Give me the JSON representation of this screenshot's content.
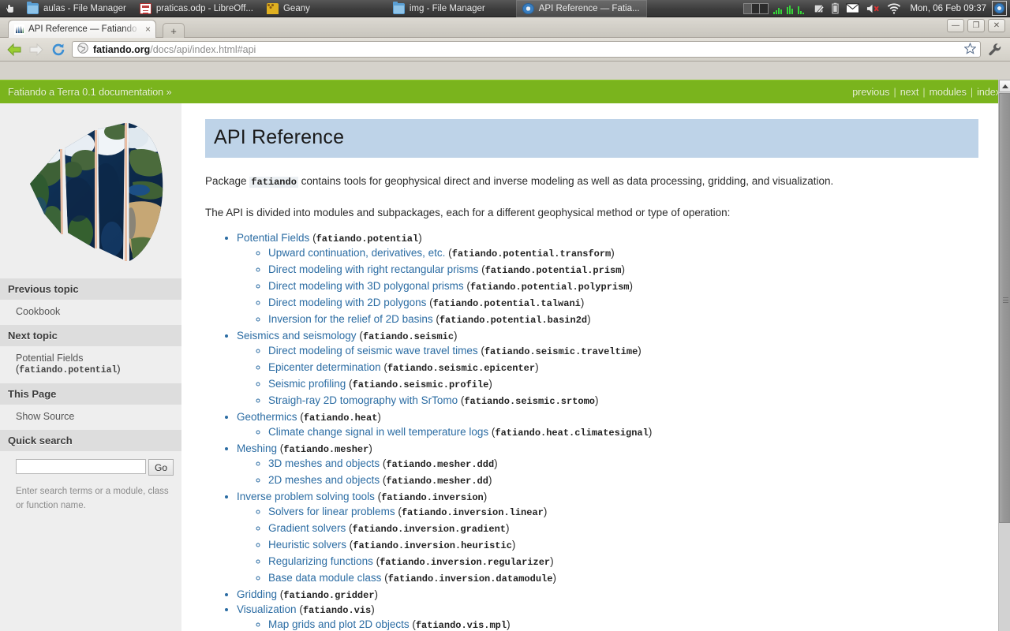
{
  "taskbar": {
    "tasks": [
      {
        "label": "aulas - File Manager",
        "icon": "folder-icon",
        "active": false
      },
      {
        "label": "praticas.odp - LibreOff...",
        "icon": "document-icon",
        "active": false
      },
      {
        "label": "Geany",
        "icon": "geany-icon",
        "active": false
      },
      {
        "label": "img - File Manager",
        "icon": "folder-icon",
        "active": false
      },
      {
        "label": "API Reference — Fatia...",
        "icon": "chromium-icon",
        "active": true
      }
    ],
    "clock": "Mon, 06 Feb  09:37",
    "tray_icons": [
      "workspace-switcher",
      "system-monitor",
      "notes-icon",
      "battery-icon",
      "mail-icon",
      "volume-muted-icon",
      "wifi-icon"
    ],
    "launcher_icon": "chromium-icon"
  },
  "browser": {
    "tab": {
      "title": "API Reference — Fatiando",
      "favicon": "fatiando-favicon",
      "close_label": "×"
    },
    "newtab_label": "+",
    "window_buttons": {
      "minimize": "—",
      "maximize": "❐",
      "close": "✕"
    },
    "nav": {
      "back": "back-arrow",
      "forward": "forward-arrow",
      "reload": "reload-icon"
    },
    "url": {
      "domain": "fatiando.org",
      "path": "/docs/api/index.html#api"
    },
    "bookmark_label": "☆",
    "menu_label": "wrench-icon"
  },
  "relbar": {
    "breadcrumb": "Fatiando a Terra 0.1 documentation »",
    "links": [
      "previous",
      "next",
      "modules",
      "index"
    ],
    "separator": "|",
    "background": "#7ab41d"
  },
  "sidebar": {
    "logo": "fatiando-globe-logo",
    "sections": [
      {
        "heading": "Previous topic",
        "link": "Cookbook",
        "code": ""
      },
      {
        "heading": "Next topic",
        "link": "Potential Fields",
        "code": "fatiando.potential"
      },
      {
        "heading": "This Page",
        "link": "Show Source",
        "code": ""
      }
    ],
    "search": {
      "heading": "Quick search",
      "value": "",
      "placeholder": "",
      "button": "Go",
      "hint": "Enter search terms or a module, class or function name."
    }
  },
  "content": {
    "title": "API Reference",
    "title_bg": "#bed3e8",
    "para1_before": "Package ",
    "para1_code": "fatiando",
    "para1_after": " contains tools for geophysical direct and inverse modeling as well as data processing, gridding, and visualization.",
    "para2": "The API is divided into modules and subpackages, each for a different geophysical method or type of operation:",
    "link_color": "#2b6ca3",
    "modules": [
      {
        "label": "Potential Fields",
        "code": "fatiando.potential",
        "children": [
          {
            "label": "Upward continuation, derivatives, etc.",
            "code": "fatiando.potential.transform"
          },
          {
            "label": "Direct modeling with right rectangular prisms",
            "code": "fatiando.potential.prism"
          },
          {
            "label": "Direct modeling with 3D polygonal prisms",
            "code": "fatiando.potential.polyprism"
          },
          {
            "label": "Direct modeling with 2D polygons",
            "code": "fatiando.potential.talwani"
          },
          {
            "label": "Inversion for the relief of 2D basins",
            "code": "fatiando.potential.basin2d"
          }
        ]
      },
      {
        "label": "Seismics and seismology",
        "code": "fatiando.seismic",
        "children": [
          {
            "label": "Direct modeling of seismic wave travel times",
            "code": "fatiando.seismic.traveltime"
          },
          {
            "label": "Epicenter determination",
            "code": "fatiando.seismic.epicenter"
          },
          {
            "label": "Seismic profiling",
            "code": "fatiando.seismic.profile"
          },
          {
            "label": "Straigh-ray 2D tomography with SrTomo",
            "code": "fatiando.seismic.srtomo"
          }
        ]
      },
      {
        "label": "Geothermics",
        "code": "fatiando.heat",
        "children": [
          {
            "label": "Climate change signal in well temperature logs",
            "code": "fatiando.heat.climatesignal"
          }
        ]
      },
      {
        "label": "Meshing",
        "code": "fatiando.mesher",
        "children": [
          {
            "label": "3D meshes and objects",
            "code": "fatiando.mesher.ddd"
          },
          {
            "label": "2D meshes and objects",
            "code": "fatiando.mesher.dd"
          }
        ]
      },
      {
        "label": "Inverse problem solving tools",
        "code": "fatiando.inversion",
        "children": [
          {
            "label": "Solvers for linear problems",
            "code": "fatiando.inversion.linear"
          },
          {
            "label": "Gradient solvers",
            "code": "fatiando.inversion.gradient"
          },
          {
            "label": "Heuristic solvers",
            "code": "fatiando.inversion.heuristic"
          },
          {
            "label": "Regularizing functions",
            "code": "fatiando.inversion.regularizer"
          },
          {
            "label": "Base data module class",
            "code": "fatiando.inversion.datamodule"
          }
        ]
      },
      {
        "label": "Gridding",
        "code": "fatiando.gridder",
        "children": []
      },
      {
        "label": "Visualization",
        "code": "fatiando.vis",
        "children": [
          {
            "label": "Map grids and plot 2D objects",
            "code": "fatiando.vis.mpl"
          }
        ]
      }
    ]
  }
}
